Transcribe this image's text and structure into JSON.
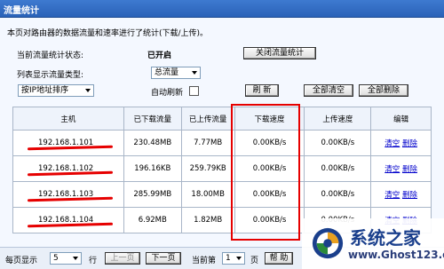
{
  "window": {
    "title": "流量统计"
  },
  "description": "本页对路由器的数据流量和速率进行了统计(下载/上传)。",
  "status": {
    "label": "当前流量统计状态:",
    "value": "已开启",
    "toggle_button": "关闭流量统计"
  },
  "display_type": {
    "label": "列表显示流量类型:",
    "selected": "总流量"
  },
  "sort": {
    "selected": "按IP地址排序",
    "auto_refresh_label": "自动刷新",
    "auto_refresh_checked": false
  },
  "actions": {
    "refresh": "刷 新",
    "clear_all": "全部清空",
    "delete_all": "全部删除"
  },
  "table": {
    "headers": [
      "主机",
      "已下载流量",
      "已上传流量",
      "下载速度",
      "上传速度",
      "编辑"
    ],
    "rows": [
      {
        "host": "192.168.1.101",
        "downloaded": "230.48MB",
        "uploaded": "7.77MB",
        "down_speed": "0.00KB/s",
        "up_speed": "0.00KB/s",
        "clear": "清空",
        "delete": "删除"
      },
      {
        "host": "192.168.1.102",
        "downloaded": "196.16KB",
        "uploaded": "259.79KB",
        "down_speed": "0.00KB/s",
        "up_speed": "0.00KB/s",
        "clear": "清空",
        "delete": "删除"
      },
      {
        "host": "192.168.1.103",
        "downloaded": "285.99MB",
        "uploaded": "18.00MB",
        "down_speed": "0.00KB/s",
        "up_speed": "0.00KB/s",
        "clear": "清空",
        "delete": "删除"
      },
      {
        "host": "192.168.1.104",
        "downloaded": "6.92MB",
        "uploaded": "1.82MB",
        "down_speed": "0.00KB/s",
        "up_speed": "0.00KB/s",
        "clear": "清空",
        "delete": "删除"
      }
    ]
  },
  "pagination": {
    "per_page_label": "每页显示",
    "per_page_value": "5",
    "rows_unit": "行",
    "prev": "上一页",
    "next": "下一页",
    "current_label": "当前第",
    "current_page": "1",
    "page_unit": "页",
    "help": "帮 助"
  },
  "watermark": {
    "title": "系统之家",
    "url": "www.Ghost123.com"
  },
  "colors": {
    "titlebar": "#2a62b8",
    "highlight": "#e60000",
    "link": "#0000cc"
  }
}
